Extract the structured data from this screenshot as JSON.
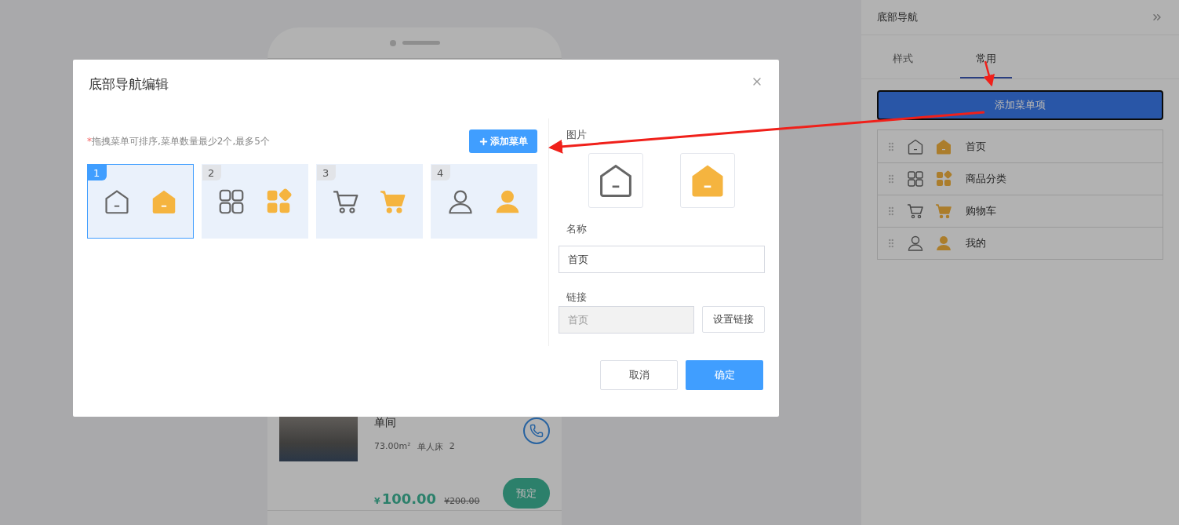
{
  "background_preview": {
    "room_name": "单间",
    "area": "73.00m²",
    "bed": "单人床",
    "count": "2",
    "price_symbol": "¥",
    "price": "100.00",
    "original_price": "¥200.00",
    "book_button": "预定"
  },
  "settings_panel": {
    "title": "底部导航",
    "tabs": [
      {
        "label": "样式",
        "selected": false
      },
      {
        "label": "常用",
        "selected": true
      }
    ],
    "add_button": "添加菜单项",
    "items": [
      {
        "kind": "home",
        "label": "首页"
      },
      {
        "kind": "grid",
        "label": "商品分类"
      },
      {
        "kind": "cart",
        "label": "购物车"
      },
      {
        "kind": "user",
        "label": "我的"
      }
    ]
  },
  "dialog": {
    "title": "底部导航编辑",
    "required_mark": "*",
    "hint": "拖拽菜单可排序,菜单数量最少2个,最多5个",
    "add_button": "添加菜单",
    "menus": [
      {
        "number": "1",
        "kind": "home",
        "selected": true
      },
      {
        "number": "2",
        "kind": "grid",
        "selected": false
      },
      {
        "number": "3",
        "kind": "cart",
        "selected": false
      },
      {
        "number": "4",
        "kind": "user",
        "selected": false
      }
    ],
    "icon_label": "图片",
    "name_label": "名称",
    "name_value": "首页",
    "link_label": "链接",
    "link_value": "首页",
    "set_link_button": "设置链接",
    "cancel_button": "取消",
    "confirm_button": "确定"
  }
}
